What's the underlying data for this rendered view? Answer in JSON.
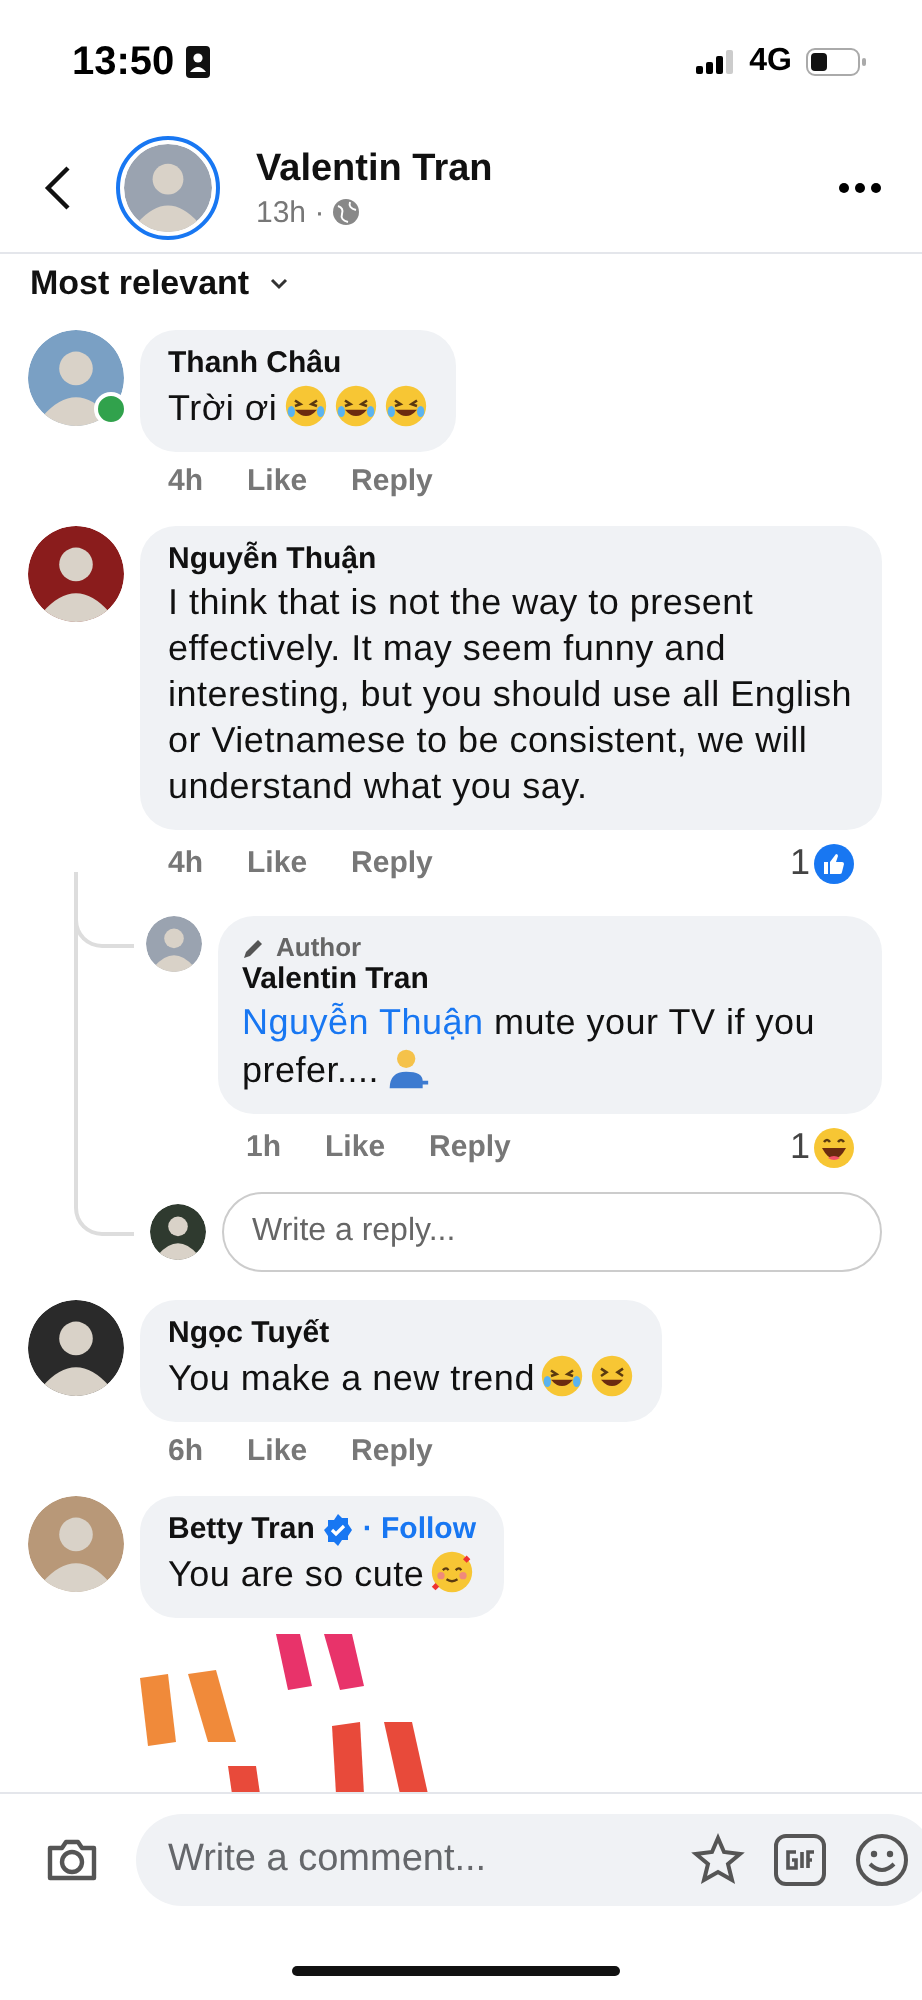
{
  "status_bar": {
    "time": "13:50",
    "network": "4G"
  },
  "header": {
    "name": "Valentin Tran",
    "time": "13h ·"
  },
  "sort": {
    "label": "Most relevant"
  },
  "comments": [
    {
      "author": "Thanh Châu",
      "online": true,
      "verified": false,
      "text": "Trời ơi",
      "emoji": [
        {
          "kind": "rofl"
        },
        {
          "kind": "rofl"
        },
        {
          "kind": "rofl"
        }
      ],
      "time": "4h",
      "like": "Like",
      "reply": "Reply"
    },
    {
      "author": "Nguyễn Thuận",
      "online": false,
      "verified": false,
      "text": "I think that is not the way to present effectively. It may seem funny and interesting, but you should use all English or Vietnamese to be consistent, we will understand what you say.",
      "time": "4h",
      "like": "Like",
      "reply": "Reply",
      "reaction": {
        "count": "1",
        "kind": "like"
      },
      "replies": [
        {
          "badge": "Author",
          "author": "Valentin Tran",
          "mention": "Nguyễn Thuận",
          "text": "mute your TV if you prefer....",
          "emoji": [
            {
              "kind": "shrug"
            }
          ],
          "time": "1h",
          "like": "Like",
          "reply": "Reply",
          "reaction": {
            "count": "1",
            "kind": "haha"
          }
        }
      ],
      "reply_field": {
        "placeholder": "Write a reply..."
      }
    },
    {
      "author": "Ngọc Tuyết",
      "online": false,
      "verified": false,
      "text": "You make a new trend",
      "emoji": [
        {
          "kind": "rofl"
        },
        {
          "kind": "grin"
        }
      ],
      "time": "6h",
      "like": "Like",
      "reply": "Reply"
    },
    {
      "author": "Betty Tran",
      "online": false,
      "verified": true,
      "follow": "· Follow",
      "text": "You are so cute",
      "emoji": [
        {
          "kind": "hearts"
        }
      ],
      "sticker": {
        "kind": "picture"
      }
    }
  ],
  "composer": {
    "placeholder": "Write a comment..."
  }
}
